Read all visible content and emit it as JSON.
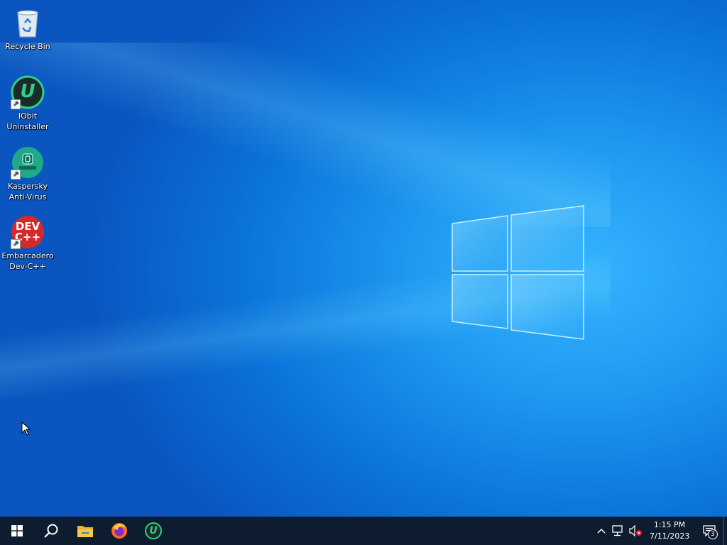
{
  "desktop": {
    "icons": [
      {
        "label_line1": "Recycle Bin",
        "label_line2": "",
        "icon": "recycle-bin-icon"
      },
      {
        "label_line1": "IObit",
        "label_line2": "Uninstaller",
        "icon": "iobit-uninstaller-icon"
      },
      {
        "label_line1": "Kaspersky",
        "label_line2": "Anti-Virus",
        "icon": "kaspersky-icon"
      },
      {
        "label_line1": "Embarcadero",
        "label_line2": "Dev-C++",
        "icon": "devcpp-icon"
      }
    ],
    "devcpp_icon_text_top": "DEV",
    "devcpp_icon_text_bottom": "C++",
    "iobit_icon_letter": "U"
  },
  "taskbar": {
    "pinned": [
      {
        "name": "start-button",
        "icon": "windows-icon"
      },
      {
        "name": "search-button",
        "icon": "search-icon"
      },
      {
        "name": "file-explorer",
        "icon": "folder-icon"
      },
      {
        "name": "firefox",
        "icon": "firefox-icon"
      },
      {
        "name": "iobit-uninstaller",
        "icon": "iobit-uninstaller-icon"
      }
    ],
    "iobit_letter": "U",
    "clock": {
      "time": "1:15 PM",
      "date": "7/11/2023"
    },
    "notification_count": "3"
  },
  "colors": {
    "accent": "#0a72d8",
    "taskbar_bg": "#0d1c2e",
    "iobit_green": "#2ecf8a",
    "kaspersky_green": "#1fa989",
    "devcpp_red": "#d42a2a"
  }
}
